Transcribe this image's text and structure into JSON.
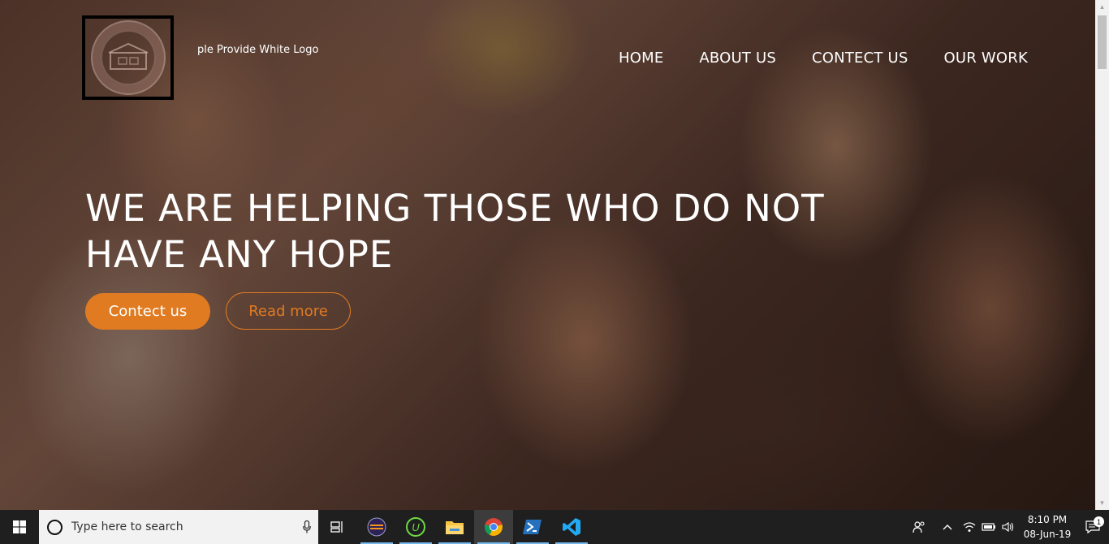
{
  "site": {
    "logo_text": "ple Provide White Logo",
    "nav": [
      "HOME",
      "ABOUT US",
      "CONTECT US",
      "OUR WORK"
    ],
    "headline": "WE ARE HELPING THOSE WHO DO NOT HAVE ANY HOPE",
    "primary_button": "Contect us",
    "secondary_button": "Read more",
    "accent_color": "#e07b22"
  },
  "taskbar": {
    "search_placeholder": "Type here to search",
    "time": "8:10 PM",
    "date": "08-Jun-19",
    "notification_count": "1",
    "pinned_icons": [
      "task-view-icon",
      "eclipse-icon",
      "upwork-icon",
      "file-explorer-icon",
      "chrome-icon",
      "powershell-icon",
      "vscode-icon"
    ]
  }
}
